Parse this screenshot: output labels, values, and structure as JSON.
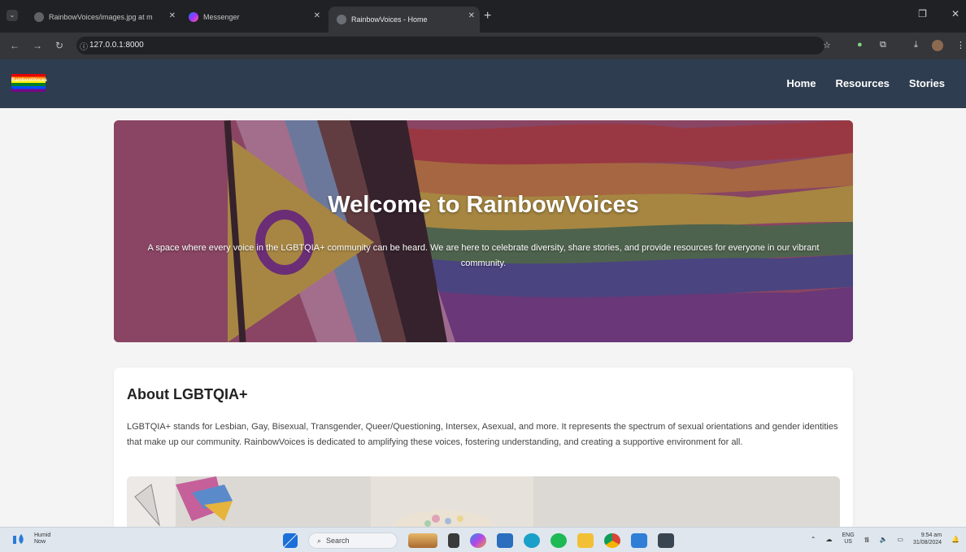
{
  "browser": {
    "tabs": [
      {
        "title": "RainbowVoices/images.jpg at m",
        "active": false
      },
      {
        "title": "Messenger",
        "active": false
      },
      {
        "title": "RainbowVoices - Home",
        "active": true
      }
    ],
    "url": "127.0.0.1:8000"
  },
  "site": {
    "logo_text": "RainbowVoices",
    "nav": [
      "Home",
      "Resources",
      "Stories"
    ]
  },
  "hero": {
    "title": "Welcome to RainbowVoices",
    "text": "A space where every voice in the LGBTQIA+ community can be heard. We are here to celebrate diversity, share stories, and provide resources for everyone in our vibrant community."
  },
  "about": {
    "heading": "About LGBTQIA+",
    "text": "LGBTQIA+ stands for Lesbian, Gay, Bisexual, Transgender, Queer/Questioning, Intersex, Asexual, and more. It represents the spectrum of sexual orientations and gender identities that make up our community. RainbowVoices is dedicated to amplifying these voices, fostering understanding, and creating a supportive environment for all."
  },
  "taskbar": {
    "weather_title": "Humid",
    "weather_sub": "Now",
    "search_placeholder": "Search",
    "lang_top": "ENG",
    "lang_bottom": "US",
    "time": "9:54 am",
    "date": "31/08/2024"
  },
  "colors": {
    "header_bg": "#2f3d50",
    "page_bg": "#f4f4f4",
    "hero_overlay": "#8a4a66"
  }
}
